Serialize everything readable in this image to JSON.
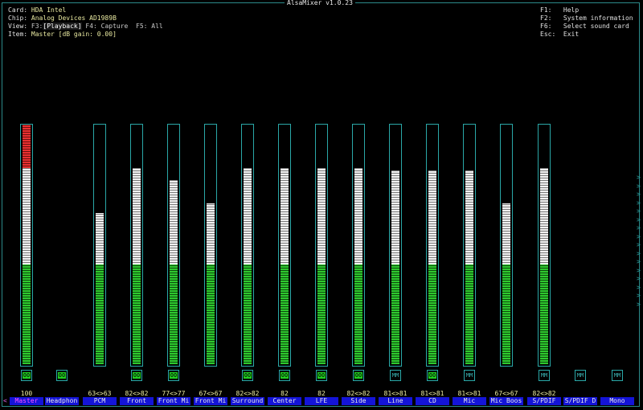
{
  "window": {
    "title": "AlsaMixer v1.0.23"
  },
  "info": {
    "card_label": "Card:",
    "card_value": "HDA Intel",
    "chip_label": "Chip:",
    "chip_value": "Analog Devices AD1989B",
    "view_label": "View:",
    "view_f3": "F3:",
    "view_playback": "[Playback]",
    "view_f4": "F4: Capture",
    "view_f5": "F5: All",
    "item_label": "Item:",
    "item_value": "Master [dB gain: 0.00]"
  },
  "help": [
    {
      "key": "F1:",
      "text": "Help"
    },
    {
      "key": "F2:",
      "text": "System information"
    },
    {
      "key": "F6:",
      "text": "Select sound card"
    },
    {
      "key": "Esc:",
      "text": "Exit"
    }
  ],
  "colors": {
    "green": "#2ec82e",
    "white": "#f0f0f0",
    "red": "#e83030",
    "border": "#2aa8a8",
    "label_bg": "#1414d8",
    "active_label": "#ff50ff"
  },
  "channels": [
    {
      "name": "Master",
      "value": "100",
      "level": 100,
      "switch": "OO",
      "switch_on": true,
      "has_bar": true,
      "active": true
    },
    {
      "name": "Headphon",
      "value": "",
      "level": 0,
      "switch": "OO",
      "switch_on": true,
      "has_bar": false,
      "active": false
    },
    {
      "name": "PCM",
      "value": "63<>63",
      "level": 63,
      "switch": "",
      "switch_on": false,
      "has_bar": true,
      "active": false
    },
    {
      "name": "Front",
      "value": "82<>82",
      "level": 82,
      "switch": "OO",
      "switch_on": true,
      "has_bar": true,
      "active": false
    },
    {
      "name": "Front Mi",
      "value": "77<>77",
      "level": 77,
      "switch": "OO",
      "switch_on": true,
      "has_bar": true,
      "active": false
    },
    {
      "name": "Front Mi",
      "value": "67<>67",
      "level": 67,
      "switch": "",
      "switch_on": false,
      "has_bar": true,
      "active": false
    },
    {
      "name": "Surround",
      "value": "82<>82",
      "level": 82,
      "switch": "OO",
      "switch_on": true,
      "has_bar": true,
      "active": false
    },
    {
      "name": "Center",
      "value": "82",
      "level": 82,
      "switch": "OO",
      "switch_on": true,
      "has_bar": true,
      "active": false
    },
    {
      "name": "LFE",
      "value": "82",
      "level": 82,
      "switch": "OO",
      "switch_on": true,
      "has_bar": true,
      "active": false
    },
    {
      "name": "Side",
      "value": "82<>82",
      "level": 82,
      "switch": "OO",
      "switch_on": true,
      "has_bar": true,
      "active": false
    },
    {
      "name": "Line",
      "value": "81<>81",
      "level": 81,
      "switch": "MM",
      "switch_on": false,
      "has_bar": true,
      "active": false
    },
    {
      "name": "CD",
      "value": "81<>81",
      "level": 81,
      "switch": "OO",
      "switch_on": true,
      "has_bar": true,
      "active": false
    },
    {
      "name": "Mic",
      "value": "81<>81",
      "level": 81,
      "switch": "MM",
      "switch_on": false,
      "has_bar": true,
      "active": false
    },
    {
      "name": "Mic Boos",
      "value": "67<>67",
      "level": 67,
      "switch": "",
      "switch_on": false,
      "has_bar": true,
      "active": false
    },
    {
      "name": "S/PDIF",
      "value": "82<>82",
      "level": 82,
      "switch": "MM",
      "switch_on": false,
      "has_bar": true,
      "active": false
    },
    {
      "name": "S/PDIF D",
      "value": "",
      "level": 0,
      "switch": "MM",
      "switch_on": false,
      "has_bar": false,
      "active": false
    },
    {
      "name": "Mono",
      "value": "",
      "level": 0,
      "switch": "MM",
      "switch_on": false,
      "has_bar": false,
      "active": false
    }
  ],
  "left_arrow": "<",
  "right_arrows": ">>>>>>>>>>>>>>>>"
}
